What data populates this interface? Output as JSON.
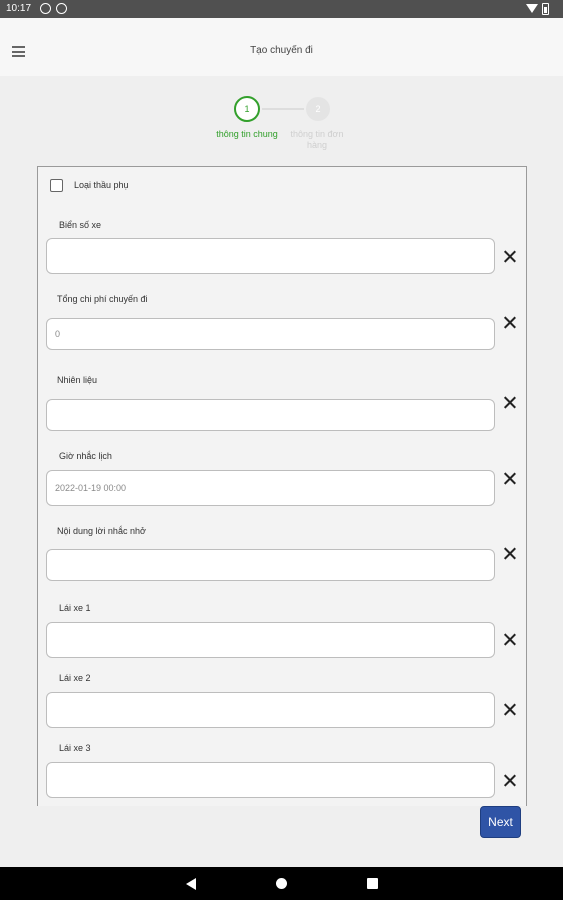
{
  "status_bar": {
    "time": "10:17",
    "icons": [
      "notification-icon",
      "app-icon",
      "wifi-icon",
      "battery-icon"
    ]
  },
  "app_bar": {
    "title": "Tạo chuyến đi",
    "menu_icon": "hamburger-menu-icon"
  },
  "stepper": {
    "steps": [
      {
        "number": "1",
        "label": "thông tin chung",
        "state": "active"
      },
      {
        "number": "2",
        "label": "thông tin đơn hàng",
        "state": "inactive"
      }
    ],
    "active_color": "#33a02c"
  },
  "form": {
    "subcontractor_checkbox": {
      "label": "Loại thầu phụ",
      "checked": false
    },
    "fields": [
      {
        "label": "Biển số xe",
        "value": "",
        "placeholder": ""
      },
      {
        "label": "Tổng chi phí chuyến đi",
        "value": "0",
        "placeholder": ""
      },
      {
        "label": "Nhiên liệu",
        "value": "",
        "placeholder": ""
      },
      {
        "label": "Giờ nhắc lịch",
        "value": "2022-01-19 00:00",
        "placeholder": ""
      },
      {
        "label": "Nội dung lời nhắc nhở",
        "value": "",
        "placeholder": ""
      },
      {
        "label": "Lái xe 1",
        "value": "",
        "placeholder": ""
      },
      {
        "label": "Lái xe 2",
        "value": "",
        "placeholder": ""
      },
      {
        "label": "Lái xe 3",
        "value": "",
        "placeholder": ""
      }
    ],
    "clear_icon": "close-icon"
  },
  "actions": {
    "next_label": "Next",
    "next_color": "#2f54a6"
  },
  "nav_bar": {
    "icons": [
      "back-icon",
      "home-icon",
      "recents-icon"
    ]
  }
}
